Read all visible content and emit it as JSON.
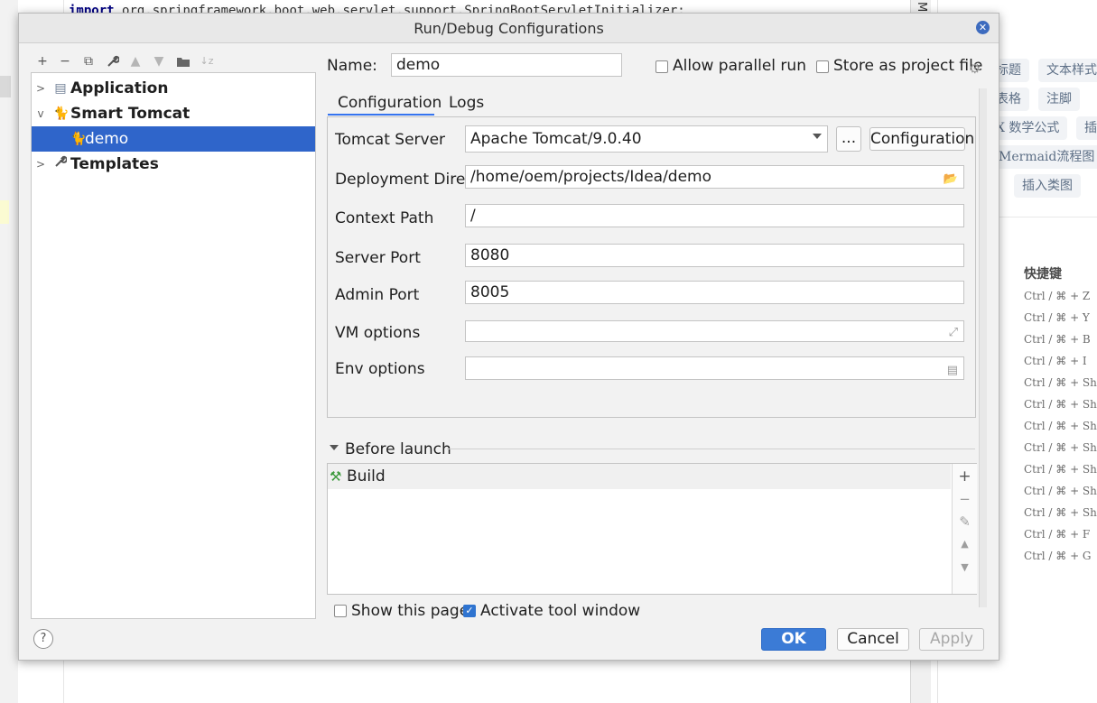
{
  "background": {
    "code_line": {
      "keyword": "import",
      "rest": "org.springframework.boot.web.servlet.support.SpringBootServletInitializer;"
    },
    "right_strip_text": "Ma",
    "typora_chips": [
      "标题",
      "文本样式",
      "表格",
      "注脚",
      "X 数学公式",
      "插",
      "Mermaid流程图",
      "插入类图"
    ],
    "shortcut_title": "快捷键",
    "shortcuts": [
      "Ctrl / ⌘ + Z",
      "Ctrl / ⌘ + Y",
      "Ctrl / ⌘ + B",
      "Ctrl / ⌘ + I",
      "Ctrl / ⌘ + Shif",
      "Ctrl / ⌘ + Shif",
      "Ctrl / ⌘ + Shif",
      "Ctrl / ⌘ + Shif",
      "Ctrl / ⌘ + Shif",
      "Ctrl / ⌘ + Shif",
      "Ctrl / ⌘ + Shif",
      "Ctrl / ⌘ + F",
      "Ctrl / ⌘ + G"
    ]
  },
  "dialog": {
    "title": "Run/Debug Configurations",
    "close_icon": "close-icon",
    "toolbar": {
      "add": "+",
      "remove": "−",
      "copy": "⧉",
      "edit_defaults": "🔧",
      "move_up": "▲",
      "move_down": "▼",
      "folder": "📁",
      "sort": "↓z"
    },
    "tree": {
      "application": "Application",
      "smart_tomcat": "Smart Tomcat",
      "demo": "demo",
      "templates": "Templates"
    },
    "name_label": "Name:",
    "name_value": "demo",
    "allow_parallel_label": "Allow parallel run",
    "allow_parallel_checked": false,
    "store_project_label": "Store as project file",
    "store_project_checked": false,
    "tabs": [
      "Configuration",
      "Logs"
    ],
    "active_tab": "Configuration",
    "form": {
      "tomcat_server_label": "Tomcat Server",
      "tomcat_server_value": "Apache Tomcat/9.0.40",
      "ellipsis_button": "...",
      "configuration_button": "Configuration",
      "deployment_label": "Deployment Dire...",
      "deployment_value": "/home/oem/projects/Idea/demo",
      "context_path_label": "Context Path",
      "context_path_value": "/",
      "server_port_label": "Server Port",
      "server_port_value": "8080",
      "admin_port_label": "Admin Port",
      "admin_port_value": "8005",
      "vm_options_label": "VM options",
      "vm_options_value": "",
      "env_options_label": "Env options",
      "env_options_value": ""
    },
    "before_launch": {
      "title": "Before launch",
      "items": [
        "Build"
      ]
    },
    "show_page_label": "Show this page",
    "show_page_checked": false,
    "activate_tool_label": "Activate tool window",
    "activate_tool_checked": true,
    "buttons": {
      "help": "?",
      "ok": "OK",
      "cancel": "Cancel",
      "apply": "Apply"
    }
  }
}
